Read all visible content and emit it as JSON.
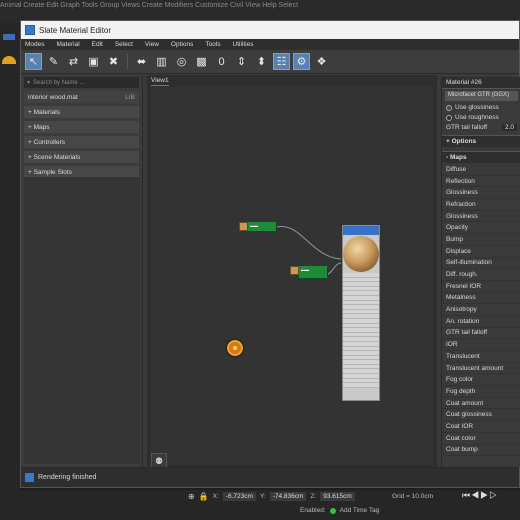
{
  "background_app": {
    "menu_text": "Animal  Create  Edit  Graph  Tools  Group  Views  Create  Modifiers  Customize  Civil View  Help  Select"
  },
  "window": {
    "title": "Slate Material Editor"
  },
  "menu": [
    "Modes",
    "Material",
    "Edit",
    "Select",
    "View",
    "Options",
    "Tools",
    "Utilities"
  ],
  "toolbar": {
    "icons": [
      "select-icon",
      "pick-material-icon",
      "put-to-scene-icon",
      "assign-icon",
      "delete-icon",
      "move-children-icon",
      "hide-icon",
      "show-map-icon",
      "show-bg-icon",
      "zero-icon",
      "layout-icon",
      "layout-children-icon",
      "arrange-icon",
      "material-id-icon",
      "checker-icon",
      "pick-icon"
    ]
  },
  "left_panel": {
    "search_placeholder": "Search by Name ...",
    "header": {
      "label": "interior wood.mat",
      "tag": "LIB"
    },
    "sections": [
      "+ Materials",
      "+ Maps",
      "+ Controllers",
      "+ Scene Materials",
      "+ Sample Slots"
    ]
  },
  "view": {
    "tab": "View1"
  },
  "right_panel": {
    "material_name": "Material #26",
    "shader": "Microfacet GTR (GGX)",
    "radio": [
      {
        "label": "Use glossiness",
        "selected": true
      },
      {
        "label": "Use roughness",
        "selected": false
      }
    ],
    "gtr_label": "GTR tail falloff",
    "gtr_value": "2.0",
    "options_label": "Options",
    "maps_label": "Maps",
    "maps": [
      "Diffuse",
      "Reflection",
      "Glossiness",
      "Refraction",
      "Glossiness",
      "Opacity",
      "Bump",
      "Displace",
      "Self-illumination",
      "Diff. rough.",
      "Fresnel IOR",
      "Metalness",
      "Anisotropy",
      "An. rotation",
      "GTR tail falloff",
      "IOR",
      "Translucent",
      "Translucent amount",
      "Fog color",
      "Fog depth",
      "Coat amount",
      "Coat glossiness",
      "Coat IOR",
      "Coat color",
      "Coat bump"
    ]
  },
  "status": {
    "text": "Rendering finished"
  },
  "bottom": {
    "x_label": "X:",
    "x_value": "-6.723cm",
    "y_label": "Y:",
    "y_value": "-74.836cm",
    "z_label": "Z:",
    "z_value": "93.615cm",
    "grid": "Grid = 10.0cm",
    "enabled_label": "Enabled:",
    "add_time_tag": "Add Time Tag"
  },
  "colors": {
    "accent": "#5a7fb0",
    "node_green": "#1f8a3a",
    "material_header": "#3b6fc8",
    "orange": "#d47a14"
  }
}
